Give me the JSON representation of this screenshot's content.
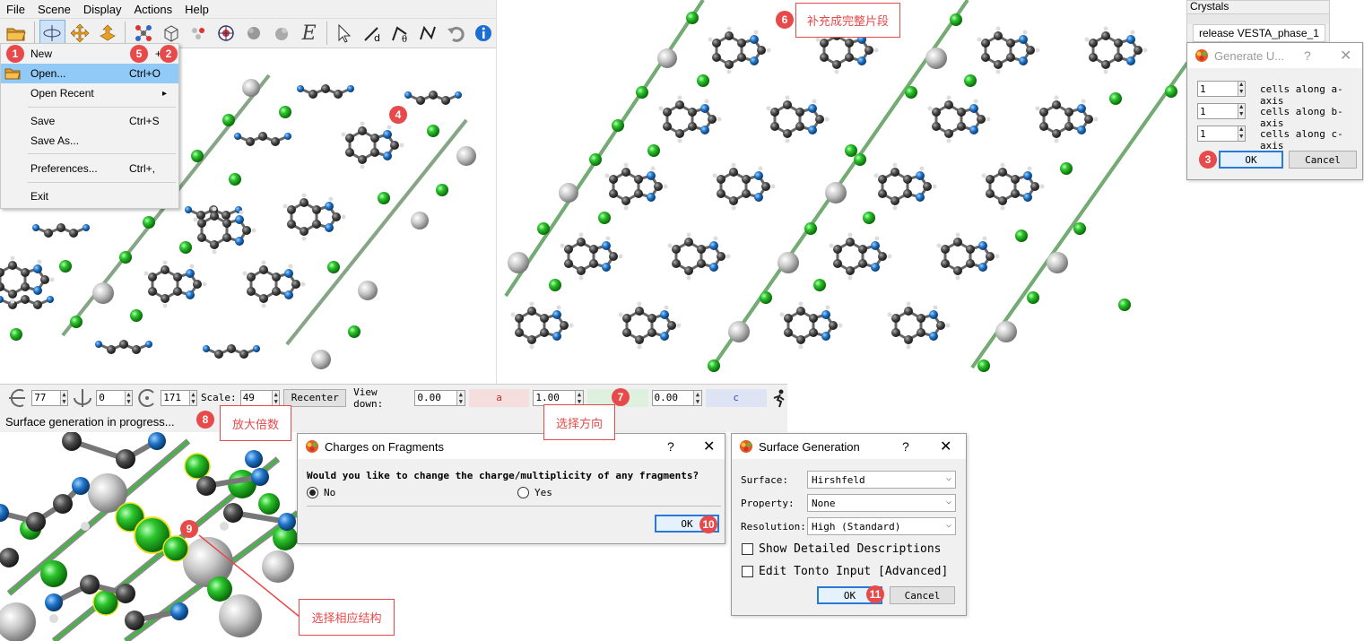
{
  "menubar": [
    "File",
    "Scene",
    "Display",
    "Actions",
    "Help"
  ],
  "file_menu": {
    "items": [
      {
        "label": "New",
        "shortcut": ""
      },
      {
        "label": "Open...",
        "shortcut": "Ctrl+O"
      },
      {
        "label": "Open Recent",
        "shortcut": ""
      },
      {
        "label": "Save",
        "shortcut": "Ctrl+S"
      },
      {
        "label": "Save As...",
        "shortcut": ""
      },
      {
        "label": "Preferences...",
        "shortcut": "Ctrl+,"
      },
      {
        "label": "Exit",
        "shortcut": ""
      }
    ],
    "new_shortcut_fragment": "+N",
    "submenu_arrow": "▸"
  },
  "markers": [
    "1",
    "2",
    "3",
    "4",
    "5",
    "6",
    "7",
    "8",
    "9",
    "10",
    "11"
  ],
  "callouts": {
    "c6": "补充成完整片段",
    "c7": "选择方向",
    "c8": "放大倍数",
    "c9": "选择相应结构"
  },
  "crystals_panel": {
    "title": "Crystals",
    "item": "release VESTA_phase_1"
  },
  "generate_dialog": {
    "title": "Generate U...",
    "help": "?",
    "close": "✕",
    "rows": [
      {
        "value": "1",
        "label": "cells along a-axis"
      },
      {
        "value": "1",
        "label": "cells along b-axis"
      },
      {
        "value": "1",
        "label": "cells along c-axis"
      }
    ],
    "ok": "OK",
    "cancel": "Cancel"
  },
  "control_bar": {
    "rot_x": "77",
    "rot_y": "0",
    "rot_z": "171",
    "scale_label": "Scale:",
    "scale": "49",
    "recenter": "Recenter",
    "view_down_label": "View down:",
    "va": "0.00",
    "a_label": "a",
    "vb": "1.00",
    "b_label": "b",
    "vc": "0.00",
    "c_label": "c"
  },
  "status": "Surface generation in progress...",
  "charges_dialog": {
    "title": "Charges on Fragments",
    "help": "?",
    "close": "✕",
    "question": "Would you like to change the charge/multiplicity of any fragments?",
    "no": "No",
    "yes": "Yes",
    "ok": "OK"
  },
  "surface_dialog": {
    "title": "Surface Generation",
    "help": "?",
    "close": "✕",
    "surface_label": "Surface:",
    "surface": "Hirshfeld",
    "property_label": "Property:",
    "property": "None",
    "resolution_label": "Resolution:",
    "resolution": "High (Standard)",
    "show_desc": "Show Detailed Descriptions",
    "edit_tonto": "Edit Tonto Input [Advanced]",
    "ok": "OK",
    "cancel": "Cancel"
  },
  "colors": {
    "accent_red": "#e64a4a",
    "chlorine": "#2cc52c",
    "nitrogen": "#1e73c8",
    "carbon": "#4a4a4a",
    "metal": "#bdbdbd",
    "ok_border": "#2b78d6"
  }
}
